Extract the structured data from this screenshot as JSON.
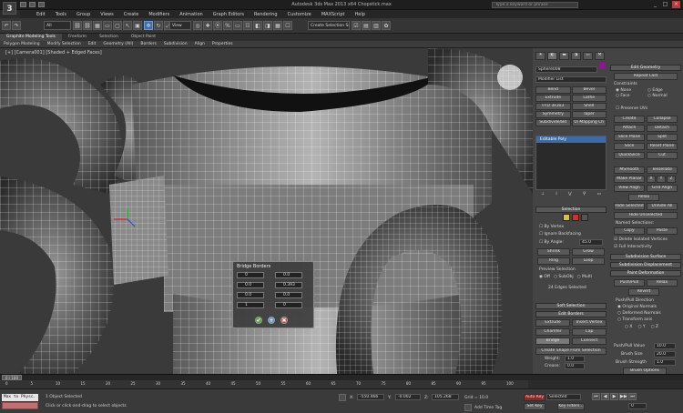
{
  "app": {
    "title": "Autodesk 3ds Max 2013 x64   Chopstick.max",
    "search_placeholder": "Type a keyword or phrase",
    "logo": "3",
    "win_buttons": [
      "_",
      "□",
      "×"
    ]
  },
  "menu": [
    "Edit",
    "Tools",
    "Group",
    "Views",
    "Create",
    "Modifiers",
    "Animation",
    "Graph Editors",
    "Rendering",
    "Customize",
    "MAXScript",
    "Help"
  ],
  "toolbar": {
    "selection_filter": "All",
    "coord_system": "View",
    "named_selection": "Create Selection Se",
    "buttons": [
      "↶",
      "↷",
      "⛓",
      "⛓",
      "▦",
      "▭",
      "▢",
      "↖",
      "▣",
      "✥",
      "↻",
      "⤢",
      "◎",
      "✚",
      "⦿",
      "%",
      "▭",
      "☷",
      "◧",
      "◨",
      "▦",
      "☐",
      "☑",
      "▤",
      "▥",
      "✿"
    ]
  },
  "ribbon": {
    "tabs": [
      "Graphite Modeling Tools",
      "Freeform",
      "Selection",
      "Object Paint"
    ],
    "active_tab": 0,
    "items": [
      "Polygon Modeling",
      "Modify Selection",
      "Edit",
      "Geometry (All)",
      "Borders",
      "Subdivision",
      "Align",
      "Properties"
    ]
  },
  "viewport": {
    "label": "[+] [Camera001] [Shaded + Edged Faces]"
  },
  "caddy": {
    "title": "Bridge Borders",
    "fields": [
      "0",
      "0.0",
      "0.0",
      "0.393",
      "0.0",
      "0.0",
      "1",
      "0"
    ],
    "buttons": [
      {
        "label": "✔",
        "color": "#5aaa3c"
      },
      {
        "label": "+",
        "color": "#6a9bd6"
      },
      {
        "label": "✖",
        "color": "#d04a4a"
      }
    ]
  },
  "command_panel": {
    "tabs": [
      "☀",
      "◐",
      "▬",
      "◑",
      "▭",
      "⚒"
    ],
    "object_name": "Sphere008",
    "object_color": "#8a1a8a",
    "modifier_list": "Modifier List",
    "modifier_buttons": [
      "Bend",
      "Bevel",
      "Extrude",
      "Lathe",
      "FFD 3x3x3",
      "Shell",
      "Symmetry",
      "Taper",
      "Subdivide/Bd",
      "Ui Mapping Ch"
    ],
    "stack_item": "Editable Poly",
    "stack_icons": [
      "⊥",
      "I",
      "⋁",
      "⚲",
      "▭"
    ],
    "selection": {
      "header": "Selection",
      "by_vertex": "By Vertex",
      "ignore_backfacing": "Ignore Backfacing",
      "by_angle": "By Angle:",
      "angle_value": "45.0",
      "shrink": "Shrink",
      "grow": "Grow",
      "ring": "Ring",
      "loop": "Loop",
      "preview": "Preview Selection",
      "preview_options": [
        "Off",
        "SubObj",
        "Multi"
      ],
      "status": "24 Edges Selected"
    },
    "soft_selection": "Soft Selection",
    "edit_borders": {
      "header": "Edit Borders",
      "buttons": [
        "Extrude",
        "Insert Vertex",
        "Chamfer",
        "Cap",
        "Bridge",
        "Connect"
      ],
      "create_shape": "Create Shape From Selection",
      "weight": "Weight:",
      "weight_value": "1.0",
      "crease": "Crease:",
      "crease_value": "0.0",
      "edit_tri": "Edit Tri.",
      "turn": "Turn"
    }
  },
  "edit_geometry": {
    "header": "Edit Geometry",
    "repeat_last": "Repeat Last",
    "constraints": "Constraints",
    "constraint_options": [
      "None",
      "Edge",
      "Face",
      "Normal"
    ],
    "preserve_uvs": "Preserve UVs",
    "buttons": [
      "Create",
      "Collapse",
      "Attach",
      "Detach",
      "Slice Plane",
      "Split",
      "Slice",
      "Reset Plane",
      "QuickSlice",
      "Cut"
    ],
    "msmooth": "MSmooth",
    "tessellate": "Tessellate",
    "make_planar": "Make Planar",
    "xyz": [
      "X",
      "Y",
      "Z"
    ],
    "view_align": "View Align",
    "grid_align": "Grid Align",
    "relax": "Relax",
    "hide_selected": "Hide Selected",
    "unhide_all": "Unhide All",
    "hide_unselected": "Hide Unselected",
    "named_selections": "Named Selections:",
    "copy": "Copy",
    "paste": "Paste",
    "delete_isolated": "Delete Isolated Vertices",
    "full_interactivity": "Full Interactivity",
    "subdivision_surface": "Subdivision Surface",
    "subdivision_displacement": "Subdivision Displacement",
    "paint_deformation": "Paint Deformation",
    "push_pull": "Push/Pull",
    "relax2": "Relax",
    "revert": "Revert",
    "push_pull_direction": "Push/Pull Direction",
    "direction_options": [
      "Original Normals",
      "Deformed Normals",
      "Transform axis"
    ],
    "axis": [
      "X",
      "Y",
      "Z"
    ],
    "push_pull_value": "Push/Pull Value",
    "ppv": "10.0",
    "brush_size": "Brush Size",
    "bs": "20.0",
    "brush_strength": "Brush Strength",
    "bst": "1.0",
    "brush_options": "Brush Options",
    "commit": "Commit",
    "cancel": "Cancel"
  },
  "timeline": {
    "frame": "0 / 100",
    "ticks": [
      "0",
      "5",
      "10",
      "15",
      "20",
      "25",
      "30",
      "35",
      "40",
      "45",
      "50",
      "55",
      "60",
      "65",
      "70",
      "75",
      "80",
      "85",
      "90",
      "95",
      "100"
    ]
  },
  "status": {
    "maxscript": "Max to Physc.",
    "line1": "1 Object Selected",
    "line2": "Click or click-and-drag to select objects",
    "x_label": "X:",
    "x_value": "-550.466",
    "y_label": "Y:",
    "y_value": "-0.002",
    "z_label": "Z:",
    "z_value": "105.268",
    "grid": "Grid = 10.0",
    "autokey": "Auto Key",
    "selected": "Selected",
    "set_key": "Set Key",
    "key_filters": "Key Filters...",
    "add_time_tag": "Add Time Tag",
    "frame_value": "0"
  }
}
